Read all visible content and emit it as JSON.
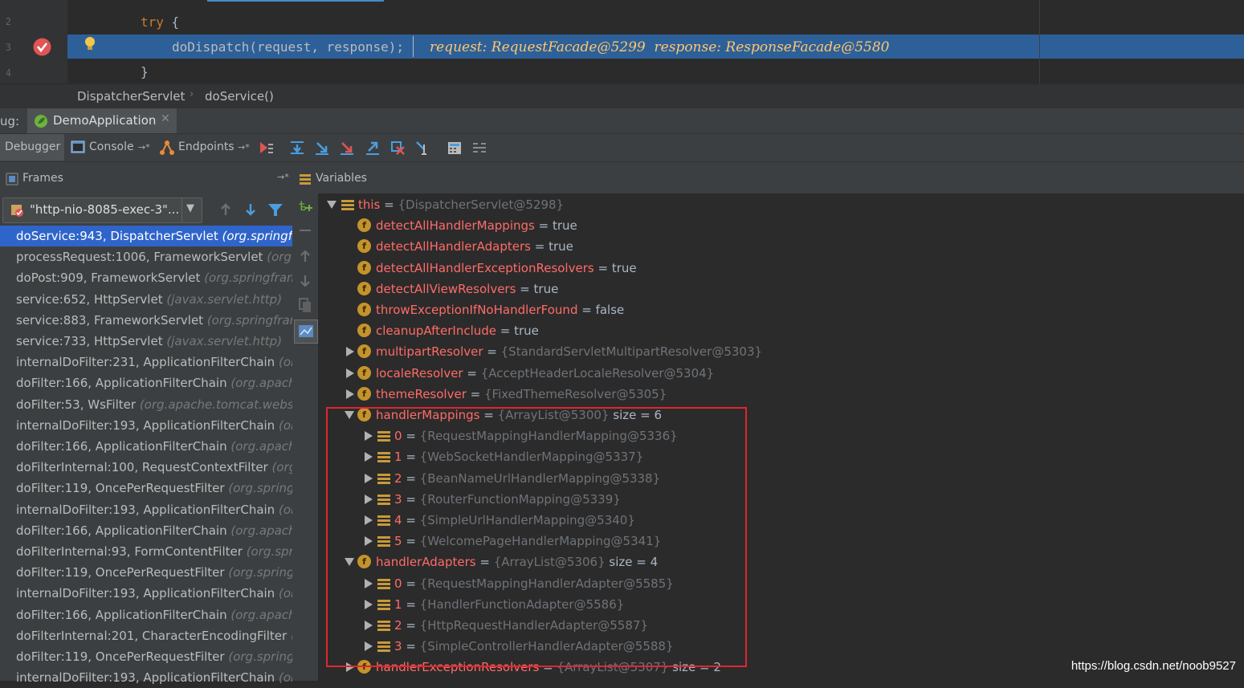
{
  "editor": {
    "line_numbers": [
      "2",
      "3",
      "4"
    ],
    "code_lines": [
      {
        "keyword": "try",
        "rest": " {"
      },
      {
        "keyword": "",
        "rest": "doDispatch(request, response);"
      },
      {
        "keyword": "",
        "rest": "}"
      }
    ],
    "inline_hint": "request: RequestFacade@5299  response: ResponseFacade@5580"
  },
  "breadcrumbs": [
    "DispatcherServlet",
    "doService()"
  ],
  "debug_tab": {
    "prefix": "ug:",
    "app_name": "DemoApplication"
  },
  "toolbar": {
    "tabs": [
      "Debugger",
      "Console",
      "Endpoints"
    ]
  },
  "frames": {
    "title": "Frames",
    "thread": "\"http-nio-8085-exec-3\"...",
    "items": [
      {
        "method": "doService:943, DispatcherServlet ",
        "pkg": "(org.springframework.web.servlet)"
      },
      {
        "method": "processRequest:1006, FrameworkServlet ",
        "pkg": "(org.springframework.web.servlet)"
      },
      {
        "method": "doPost:909, FrameworkServlet ",
        "pkg": "(org.springframework.web.servlet)"
      },
      {
        "method": "service:652, HttpServlet ",
        "pkg": "(javax.servlet.http)"
      },
      {
        "method": "service:883, FrameworkServlet ",
        "pkg": "(org.springframework.web.servlet)"
      },
      {
        "method": "service:733, HttpServlet ",
        "pkg": "(javax.servlet.http)"
      },
      {
        "method": "internalDoFilter:231, ApplicationFilterChain ",
        "pkg": "(org.apache.catalina.core)"
      },
      {
        "method": "doFilter:166, ApplicationFilterChain ",
        "pkg": "(org.apache.catalina.core)"
      },
      {
        "method": "doFilter:53, WsFilter ",
        "pkg": "(org.apache.tomcat.websocket.server)"
      },
      {
        "method": "internalDoFilter:193, ApplicationFilterChain ",
        "pkg": "(org.apache.catalina.core)"
      },
      {
        "method": "doFilter:166, ApplicationFilterChain ",
        "pkg": "(org.apache.catalina.core)"
      },
      {
        "method": "doFilterInternal:100, RequestContextFilter ",
        "pkg": "(org.springframework.web.filter)"
      },
      {
        "method": "doFilter:119, OncePerRequestFilter ",
        "pkg": "(org.springframework.web.filter)"
      },
      {
        "method": "internalDoFilter:193, ApplicationFilterChain ",
        "pkg": "(org.apache.catalina.core)"
      },
      {
        "method": "doFilter:166, ApplicationFilterChain ",
        "pkg": "(org.apache.catalina.core)"
      },
      {
        "method": "doFilterInternal:93, FormContentFilter ",
        "pkg": "(org.springframework.web.filter)"
      },
      {
        "method": "doFilter:119, OncePerRequestFilter ",
        "pkg": "(org.springframework.web.filter)"
      },
      {
        "method": "internalDoFilter:193, ApplicationFilterChain ",
        "pkg": "(org.apache.catalina.core)"
      },
      {
        "method": "doFilter:166, ApplicationFilterChain ",
        "pkg": "(org.apache.catalina.core)"
      },
      {
        "method": "doFilterInternal:201, CharacterEncodingFilter ",
        "pkg": "(org.springframework.web.filter)"
      },
      {
        "method": "doFilter:119, OncePerRequestFilter ",
        "pkg": "(org.springframework.web.filter)"
      },
      {
        "method": "internalDoFilter:193, ApplicationFilterChain ",
        "pkg": "(org.apache.catalina.core)"
      }
    ]
  },
  "variables": {
    "title": "Variables",
    "rows": [
      {
        "level": 0,
        "expander": "down",
        "icon": "list",
        "name": "this",
        "ref": "{DispatcherServlet@5298}",
        "value": "",
        "extra": ""
      },
      {
        "level": 1,
        "expander": "none",
        "icon": "field",
        "name": "detectAllHandlerMappings",
        "ref": "",
        "value": "true",
        "extra": ""
      },
      {
        "level": 1,
        "expander": "none",
        "icon": "field",
        "name": "detectAllHandlerAdapters",
        "ref": "",
        "value": "true",
        "extra": ""
      },
      {
        "level": 1,
        "expander": "none",
        "icon": "field",
        "name": "detectAllHandlerExceptionResolvers",
        "ref": "",
        "value": "true",
        "extra": ""
      },
      {
        "level": 1,
        "expander": "none",
        "icon": "field",
        "name": "detectAllViewResolvers",
        "ref": "",
        "value": "true",
        "extra": ""
      },
      {
        "level": 1,
        "expander": "none",
        "icon": "field",
        "name": "throwExceptionIfNoHandlerFound",
        "ref": "",
        "value": "false",
        "extra": ""
      },
      {
        "level": 1,
        "expander": "none",
        "icon": "field",
        "name": "cleanupAfterInclude",
        "ref": "",
        "value": "true",
        "extra": ""
      },
      {
        "level": 1,
        "expander": "right",
        "icon": "field",
        "name": "multipartResolver",
        "ref": "{StandardServletMultipartResolver@5303}",
        "value": "",
        "extra": ""
      },
      {
        "level": 1,
        "expander": "right",
        "icon": "field",
        "name": "localeResolver",
        "ref": "{AcceptHeaderLocaleResolver@5304}",
        "value": "",
        "extra": ""
      },
      {
        "level": 1,
        "expander": "right",
        "icon": "field",
        "name": "themeResolver",
        "ref": "{FixedThemeResolver@5305}",
        "value": "",
        "extra": ""
      },
      {
        "level": 1,
        "expander": "down",
        "icon": "field",
        "name": "handlerMappings",
        "ref": "{ArrayList@5300}",
        "value": "",
        "extra": "size = 6"
      },
      {
        "level": 2,
        "expander": "right",
        "icon": "list",
        "name": "0",
        "ref": "{RequestMappingHandlerMapping@5336}",
        "value": "",
        "extra": ""
      },
      {
        "level": 2,
        "expander": "right",
        "icon": "list",
        "name": "1",
        "ref": "{WebSocketHandlerMapping@5337}",
        "value": "",
        "extra": ""
      },
      {
        "level": 2,
        "expander": "right",
        "icon": "list",
        "name": "2",
        "ref": "{BeanNameUrlHandlerMapping@5338}",
        "value": "",
        "extra": ""
      },
      {
        "level": 2,
        "expander": "right",
        "icon": "list",
        "name": "3",
        "ref": "{RouterFunctionMapping@5339}",
        "value": "",
        "extra": ""
      },
      {
        "level": 2,
        "expander": "right",
        "icon": "list",
        "name": "4",
        "ref": "{SimpleUrlHandlerMapping@5340}",
        "value": "",
        "extra": ""
      },
      {
        "level": 2,
        "expander": "right",
        "icon": "list",
        "name": "5",
        "ref": "{WelcomePageHandlerMapping@5341}",
        "value": "",
        "extra": ""
      },
      {
        "level": 1,
        "expander": "down",
        "icon": "field",
        "name": "handlerAdapters",
        "ref": "{ArrayList@5306}",
        "value": "",
        "extra": "size = 4"
      },
      {
        "level": 2,
        "expander": "right",
        "icon": "list",
        "name": "0",
        "ref": "{RequestMappingHandlerAdapter@5585}",
        "value": "",
        "extra": ""
      },
      {
        "level": 2,
        "expander": "right",
        "icon": "list",
        "name": "1",
        "ref": "{HandlerFunctionAdapter@5586}",
        "value": "",
        "extra": ""
      },
      {
        "level": 2,
        "expander": "right",
        "icon": "list",
        "name": "2",
        "ref": "{HttpRequestHandlerAdapter@5587}",
        "value": "",
        "extra": ""
      },
      {
        "level": 2,
        "expander": "right",
        "icon": "list",
        "name": "3",
        "ref": "{SimpleControllerHandlerAdapter@5588}",
        "value": "",
        "extra": ""
      },
      {
        "level": 1,
        "expander": "right",
        "icon": "field",
        "name": "handlerExceptionResolvers",
        "ref": "{ArrayList@5307}",
        "value": "",
        "extra": "size = 2"
      }
    ]
  },
  "watermark": "https://blog.csdn.net/noob9527"
}
